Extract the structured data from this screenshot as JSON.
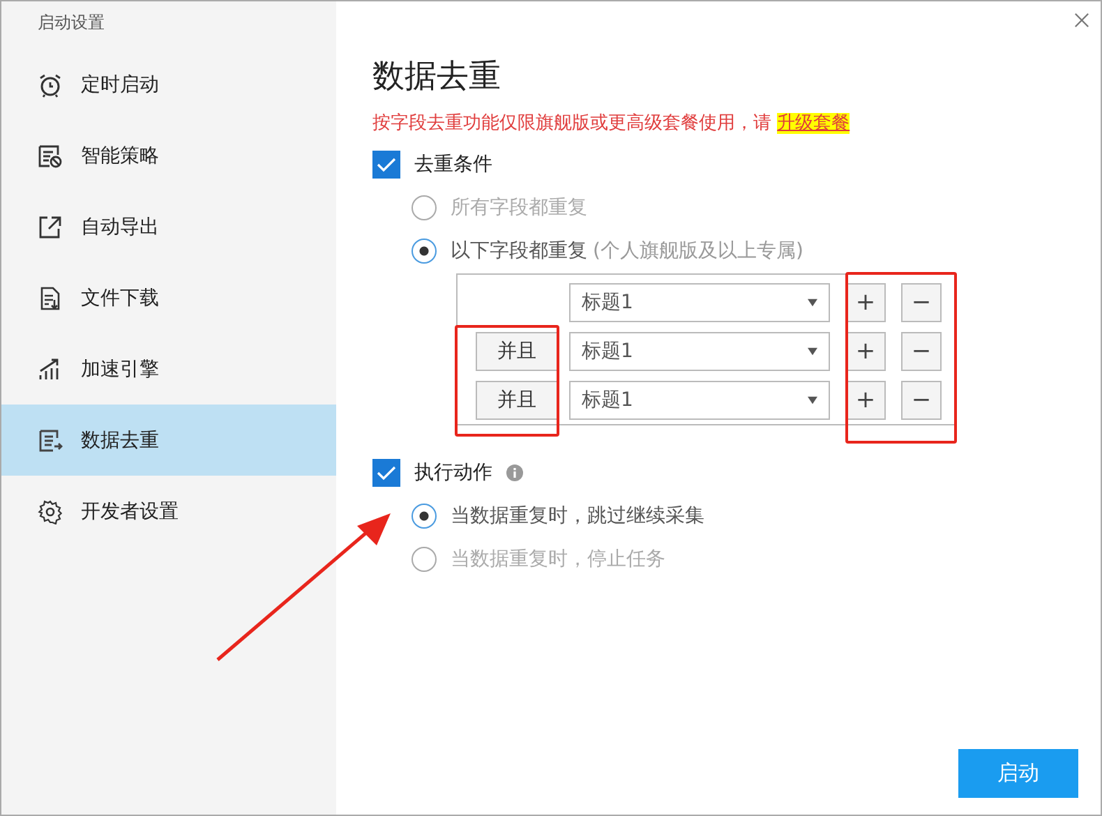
{
  "window": {
    "title": "启动设置"
  },
  "sidebar": {
    "items": [
      {
        "label": "定时启动",
        "selected": false
      },
      {
        "label": "智能策略",
        "selected": false
      },
      {
        "label": "自动导出",
        "selected": false
      },
      {
        "label": "文件下载",
        "selected": false
      },
      {
        "label": "加速引擎",
        "selected": false
      },
      {
        "label": "数据去重",
        "selected": true
      },
      {
        "label": "开发者设置",
        "selected": false
      }
    ]
  },
  "heading": "数据去重",
  "notice": {
    "text": "按字段去重功能仅限旗舰版或更高级套餐使用，请",
    "link": "升级套餐"
  },
  "condition": {
    "label": "去重条件",
    "checked": true,
    "options": [
      {
        "label": "所有字段都重复",
        "selected": false
      },
      {
        "label": "以下字段都重复",
        "note": "(个人旗舰版及以上专属)",
        "selected": true
      }
    ],
    "rows": [
      {
        "field": "标题1",
        "add": "+",
        "remove": "−"
      },
      {
        "connector": "并且",
        "field": "标题1",
        "add": "+",
        "remove": "−"
      },
      {
        "connector": "并且",
        "field": "标题1",
        "add": "+",
        "remove": "−"
      }
    ]
  },
  "action": {
    "label": "执行动作",
    "checked": true,
    "options": [
      {
        "label": "当数据重复时，跳过继续采集",
        "selected": true
      },
      {
        "label": "当数据重复时，停止任务",
        "selected": false
      }
    ]
  },
  "start_button": "启动"
}
